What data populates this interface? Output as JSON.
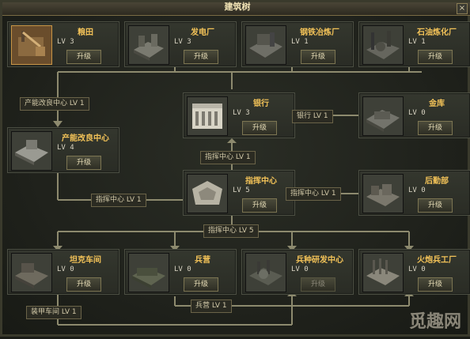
{
  "window": {
    "title": "建筑树",
    "close_label": "×"
  },
  "upgrade_label": "升级",
  "watermark": "觅趣网",
  "buildings": {
    "granary": {
      "name": "粮田",
      "level": "LV 3",
      "icon": "granary-icon"
    },
    "power_plant": {
      "name": "发电厂",
      "level": "LV 3",
      "icon": "power-plant-icon"
    },
    "steel_plant": {
      "name": "钢铁冶炼厂",
      "level": "LV 1",
      "icon": "steel-plant-icon"
    },
    "oil_refinery": {
      "name": "石油炼化厂",
      "level": "LV 1",
      "icon": "oil-refinery-icon"
    },
    "bank": {
      "name": "银行",
      "level": "LV 3",
      "icon": "bank-icon"
    },
    "vault": {
      "name": "金库",
      "level": "LV 0",
      "icon": "vault-icon"
    },
    "productivity": {
      "name": "产能改良中心",
      "level": "LV 4",
      "icon": "productivity-center-icon"
    },
    "command": {
      "name": "指挥中心",
      "level": "LV 5",
      "icon": "command-center-icon"
    },
    "logistics": {
      "name": "后勤部",
      "level": "LV 0",
      "icon": "logistics-icon"
    },
    "tank_workshop": {
      "name": "坦克车间",
      "level": "LV 0",
      "icon": "tank-workshop-icon"
    },
    "barracks": {
      "name": "兵营",
      "level": "LV 0",
      "icon": "barracks-icon"
    },
    "research": {
      "name": "兵种研发中心",
      "level": "LV 0",
      "icon": "research-center-icon"
    },
    "artillery": {
      "name": "火炮兵工厂",
      "level": "LV 0",
      "icon": "artillery-factory-icon"
    }
  },
  "requirements": {
    "productivity_lv1": "产能改良中心 LV 1",
    "bank_lv1": "银行 LV 1",
    "command_lv1_top": "指挥中心 LV 1",
    "command_lv1_left": "指挥中心 LV 1",
    "command_lv1_right": "指挥中心 LV 1",
    "command_lv5": "指挥中心 LV 5",
    "armor_lv1": "装甲车间 LV 1",
    "barracks_lv1": "兵营 LV 1"
  },
  "colors": {
    "accent": "#f2c258",
    "line": "#8d8a6e",
    "panel": "#2f3129"
  }
}
